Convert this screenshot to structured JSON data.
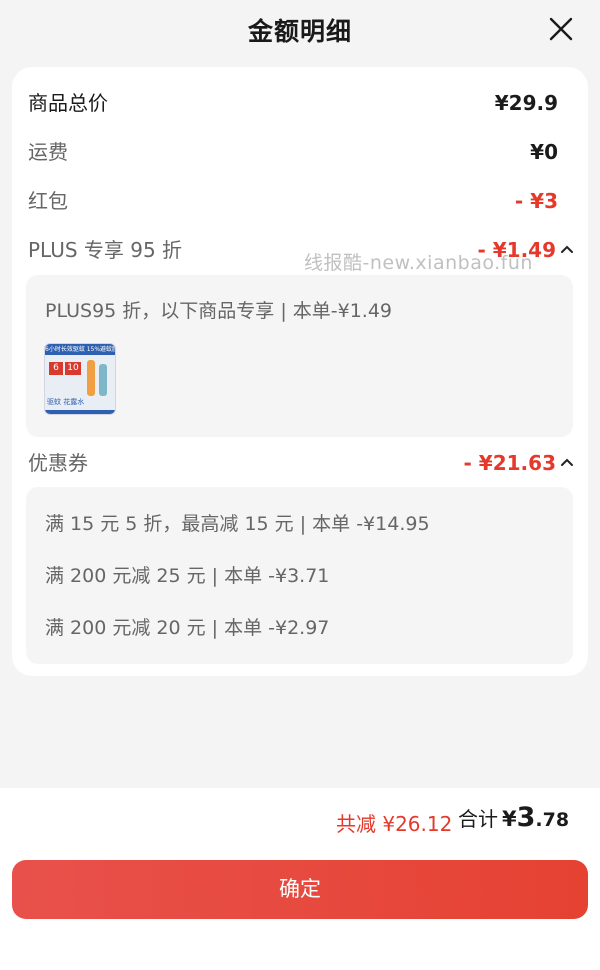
{
  "dialog": {
    "title": "金额明细"
  },
  "rows": {
    "goods": {
      "label": "商品总价",
      "value": "¥29.9"
    },
    "shipping": {
      "label": "运费",
      "value": "¥0"
    },
    "redpacket": {
      "label": "红包",
      "value": "- ¥3"
    },
    "plus": {
      "label": "PLUS 专享 95 折",
      "value": "- ¥1.49"
    },
    "coupon": {
      "label": "优惠券",
      "value": "- ¥21.63"
    }
  },
  "plus_detail": {
    "text": "PLUS95 折，以下商品专享 | 本单-¥1.49"
  },
  "product_thumb": {
    "badge_text": "6小时长效驱蚊 15%避蚊胺",
    "price_tags": [
      "6",
      "10"
    ],
    "caption": "驱蚊 花露水"
  },
  "coupon_details": [
    "满 15 元 5 折，最高减 15 元 | 本单 -¥14.95",
    "满 200 元减 25 元 | 本单 -¥3.71",
    "满 200 元减 20 元 | 本单 -¥2.97"
  ],
  "watermark": "线报酷-new.xianbao.fun",
  "summary": {
    "saved": "共减 ¥26.12",
    "total_label": "合计",
    "currency": "¥",
    "total_int": "3",
    "total_dec": ".78"
  },
  "confirm_button": "确定",
  "colors": {
    "accent_red": "#e4392b",
    "button_red": "#e64232",
    "text_grey": "#666666"
  },
  "icons": {
    "close": "close-icon",
    "collapse": "chevron-up-icon"
  }
}
